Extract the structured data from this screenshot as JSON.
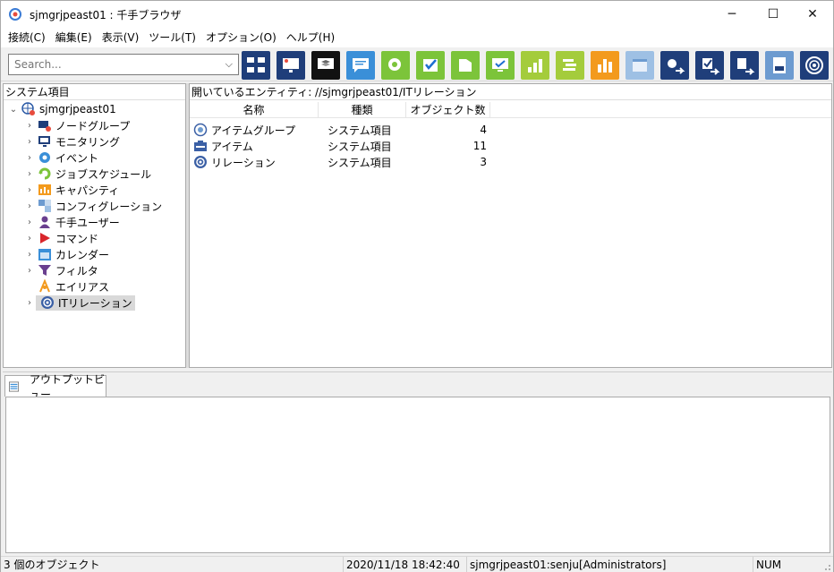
{
  "window": {
    "title": "sjmgrjpeast01 : 千手ブラウザ",
    "minimize": "─",
    "maximize": "☐",
    "close": "✕"
  },
  "menu": [
    "接続(C)",
    "編集(E)",
    "表示(V)",
    "ツール(T)",
    "オプション(O)",
    "ヘルプ(H)"
  ],
  "toolbar": {
    "search_placeholder": "Search...",
    "buttons": [
      "nodes-monitor-icon",
      "monitor-icon",
      "layers-icon",
      "message-icon",
      "gear-alert-icon",
      "check-icon",
      "map-icon",
      "display-check-icon",
      "bar-chart-icon",
      "gantt-icon",
      "orange-chart-icon",
      "window-icon",
      "export-gear-icon",
      "export-check-icon",
      "export-doc-icon",
      "log-icon",
      "radar-icon"
    ]
  },
  "left_pane": {
    "header": "システム項目",
    "root": "sjmgrjpeast01",
    "items": [
      "ノードグループ",
      "モニタリング",
      "イベント",
      "ジョブスケジュール",
      "キャパシティ",
      "コンフィグレーション",
      "千手ユーザー",
      "コマンド",
      "カレンダー",
      "フィルタ",
      "エイリアス",
      "ITリレーション"
    ]
  },
  "right_pane": {
    "header": "開いているエンティティ: //sjmgrjpeast01/ITリレーション",
    "columns": [
      "名称",
      "種類",
      "オブジェクト数"
    ],
    "rows": [
      {
        "name": "アイテムグループ",
        "type": "システム項目",
        "count": "4"
      },
      {
        "name": "アイテム",
        "type": "システム項目",
        "count": "11"
      },
      {
        "name": "リレーション",
        "type": "システム項目",
        "count": "3"
      }
    ]
  },
  "output": {
    "tab_label": "アウトプットビュー"
  },
  "status": {
    "objects": "3 個のオブジェクト",
    "datetime": "2020/11/18 18:42:40",
    "user": "sjmgrjpeast01:senju[Administrators]",
    "num": "NUM"
  }
}
